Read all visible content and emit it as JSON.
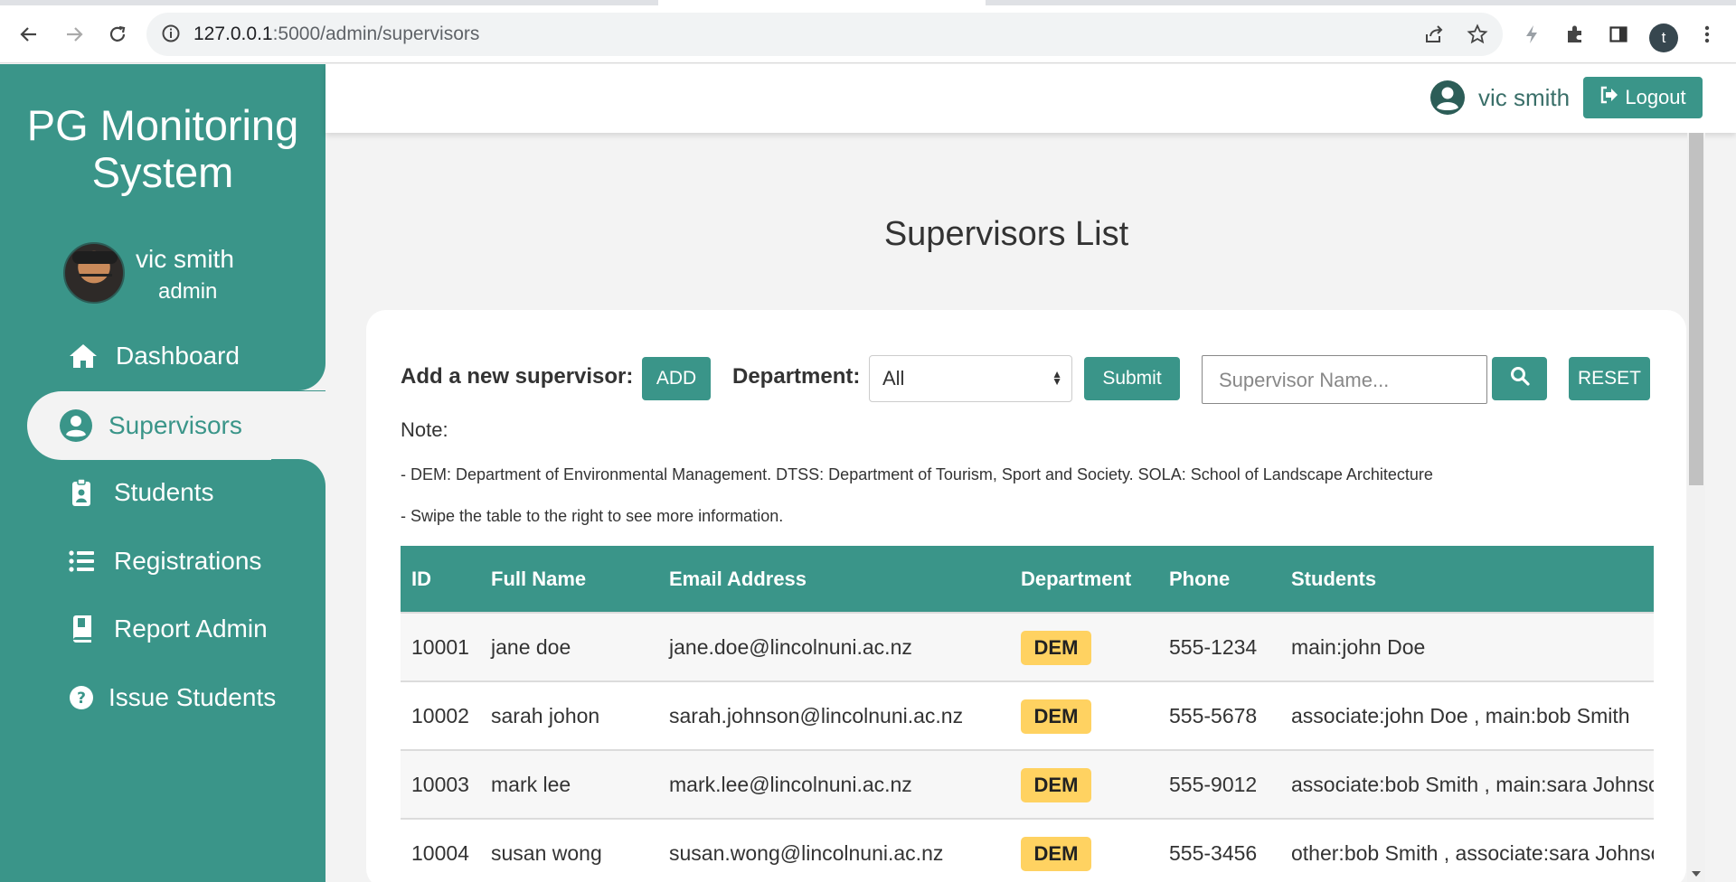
{
  "browser": {
    "url_host": "127.0.0.1",
    "url_path": ":5000/admin/supervisors",
    "profile_initial": "t"
  },
  "sidebar": {
    "brand_line1": "PG Monitoring",
    "brand_line2": "System",
    "user_name": "vic smith",
    "user_role": "admin",
    "items": [
      {
        "label": "Dashboard",
        "icon": "home-icon"
      },
      {
        "label": "Supervisors",
        "icon": "user-circle-icon",
        "active": true
      },
      {
        "label": "Students",
        "icon": "id-badge-icon"
      },
      {
        "label": "Registrations",
        "icon": "list-icon"
      },
      {
        "label": "Report Admin",
        "icon": "book-icon"
      },
      {
        "label": "Issue Students",
        "icon": "question-circle-icon"
      }
    ]
  },
  "header": {
    "user_name": "vic smith",
    "logout_label": "Logout"
  },
  "main": {
    "title": "Supervisors List",
    "add_label": "Add a new supervisor:",
    "add_button": "ADD",
    "department_label": "Department:",
    "department_selected": "All",
    "submit_button": "Submit",
    "search_placeholder": "Supervisor Name...",
    "reset_button": "RESET",
    "note_title": "Note:",
    "note_line1": "- DEM: Department of Environmental Management. DTSS: Department of Tourism, Sport and Society. SOLA: School of Landscape Architecture",
    "note_line2": "- Swipe the table to the right to see more information."
  },
  "table": {
    "headers": [
      "ID",
      "Full Name",
      "Email Address",
      "Department",
      "Phone",
      "Students"
    ],
    "rows": [
      {
        "id": "10001",
        "name": "jane doe",
        "email": "jane.doe@lincolnuni.ac.nz",
        "dept": "DEM",
        "phone": "555-1234",
        "students": "main:john Doe"
      },
      {
        "id": "10002",
        "name": "sarah johon",
        "email": "sarah.johnson@lincolnuni.ac.nz",
        "dept": "DEM",
        "phone": "555-5678",
        "students": "associate:john Doe , main:bob Smith"
      },
      {
        "id": "10003",
        "name": "mark lee",
        "email": "mark.lee@lincolnuni.ac.nz",
        "dept": "DEM",
        "phone": "555-9012",
        "students": "associate:bob Smith , main:sara Johnson"
      },
      {
        "id": "10004",
        "name": "susan wong",
        "email": "susan.wong@lincolnuni.ac.nz",
        "dept": "DEM",
        "phone": "555-3456",
        "students": "other:bob Smith , associate:sara Johnson"
      }
    ]
  },
  "colors": {
    "primary": "#3a9589",
    "badge": "#ffd261",
    "background": "#f3f3f3"
  }
}
